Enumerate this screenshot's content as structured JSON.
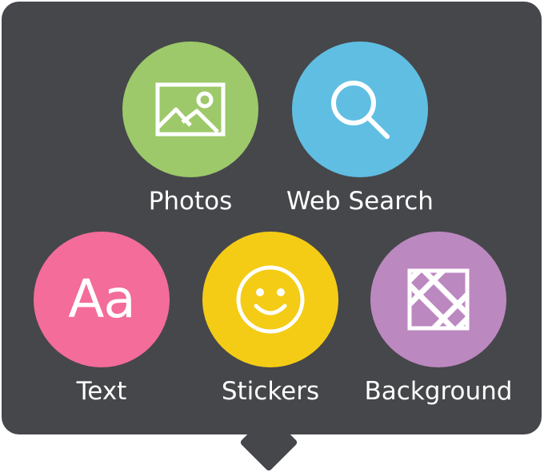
{
  "menu": {
    "items": [
      {
        "label": "Photos",
        "icon": "photo-icon",
        "color": "#9dc96a"
      },
      {
        "label": "Web Search",
        "icon": "search-icon",
        "color": "#60bee3"
      },
      {
        "label": "Text",
        "icon": "text-icon",
        "glyph": "Aa",
        "color": "#f36c9a"
      },
      {
        "label": "Stickers",
        "icon": "smiley-icon",
        "color": "#f4cc16"
      },
      {
        "label": "Background",
        "icon": "background-pattern-icon",
        "color": "#bc88c0"
      }
    ],
    "background_color": "#46474b"
  }
}
